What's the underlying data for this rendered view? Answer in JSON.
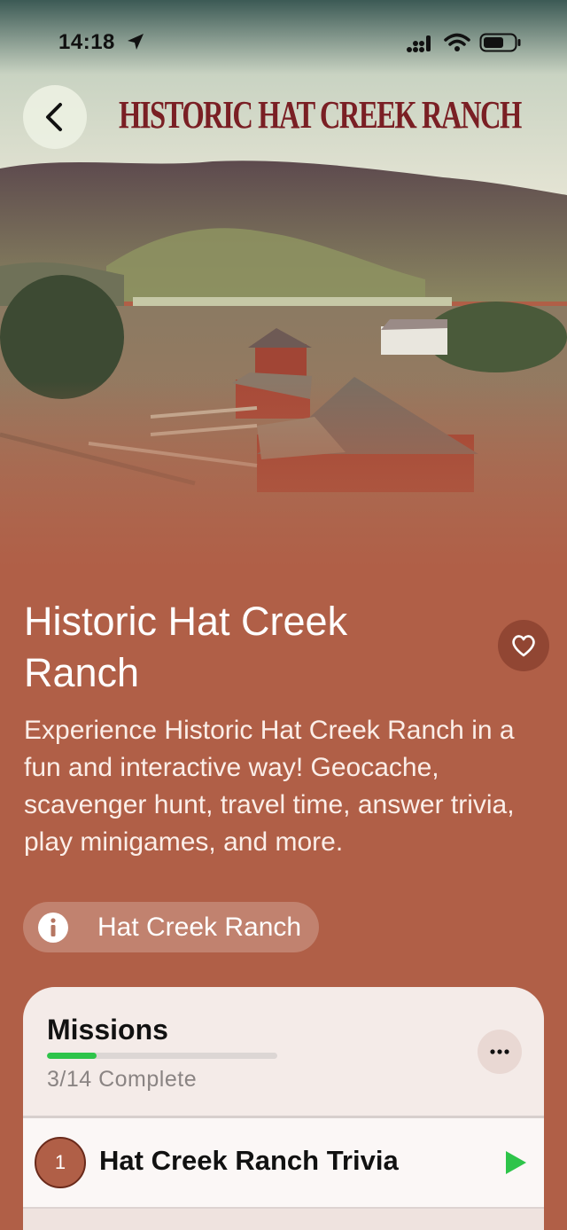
{
  "status_bar": {
    "time": "14:18",
    "icons": [
      "location-arrow-icon",
      "cellular-signal-icon",
      "wifi-icon",
      "battery-icon"
    ]
  },
  "header": {
    "back_icon": "chevron-left-icon",
    "logo_text": "HISTORIC HAT CREEK RANCH"
  },
  "experience": {
    "title": "Historic Hat Creek Ranch",
    "favorite_icon": "heart-outline-icon",
    "description": "Experience Historic Hat Creek Ranch in a fun and interactive way! Geocache, scavenger hunt, travel time, answer trivia, play minigames, and more.",
    "location_chip": {
      "icon": "info-icon",
      "label": "Hat Creek Ranch"
    }
  },
  "missions": {
    "title": "Missions",
    "completed": 3,
    "total": 14,
    "progress_fraction": 0.214,
    "progress_text": "3/14  Complete",
    "more_icon": "ellipsis-icon",
    "items": [
      {
        "number": "1",
        "name": "Hat Creek Ranch Trivia",
        "action_icon": "play-icon"
      }
    ]
  },
  "colors": {
    "background": "#b05f47",
    "card": "#f4ebe8",
    "progress": "#2ec44a",
    "logo": "#7a1f24"
  }
}
